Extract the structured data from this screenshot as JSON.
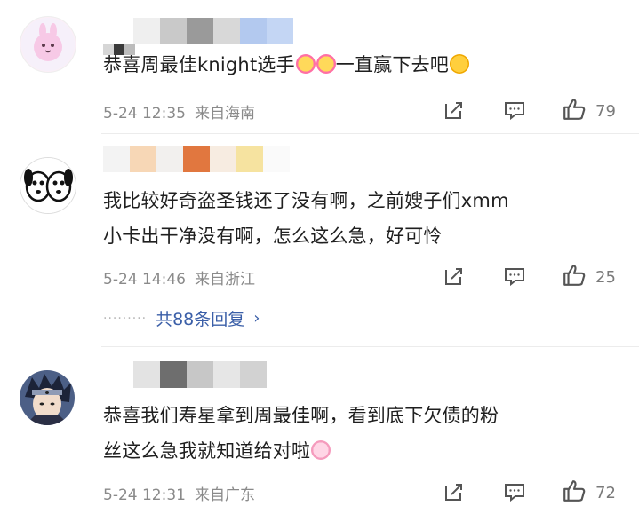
{
  "comments": [
    {
      "text_before": "恭喜周最佳knight选手",
      "text_after": "一直赢下去吧",
      "emoji1": "sparkling-heart-emoji",
      "emoji2": "sparkling-heart-emoji",
      "emoji3": "heart-eyes-emoji",
      "time": "5-24 12:35",
      "location": "来自海南",
      "likes": "79",
      "avatar": "bunny-avatar"
    },
    {
      "line1": "我比较好奇盗圣钱还了没有啊，之前嫂子们xmm",
      "line2": "小卡出干净没有啊，怎么这么急，好可怜",
      "time": "5-24 14:46",
      "location": "来自浙江",
      "likes": "25",
      "replies": "共88条回复",
      "avatar": "cartoon-dogs-avatar"
    },
    {
      "line1": "恭喜我们寿星拿到周最佳啊，看到底下欠债的粉",
      "line2": "丝这么急我就知道给对啦",
      "emoji": "pink-bunny-emoji",
      "time": "5-24 12:31",
      "location": "来自广东",
      "likes": "72",
      "avatar": "anime-character-avatar"
    }
  ],
  "icons": {
    "share": "share-icon",
    "comment": "comment-icon",
    "like": "thumbs-up-icon",
    "chevron": "chevron-right-icon"
  },
  "colors": {
    "link": "#3b5fa8",
    "meta": "#8a8a8a"
  }
}
